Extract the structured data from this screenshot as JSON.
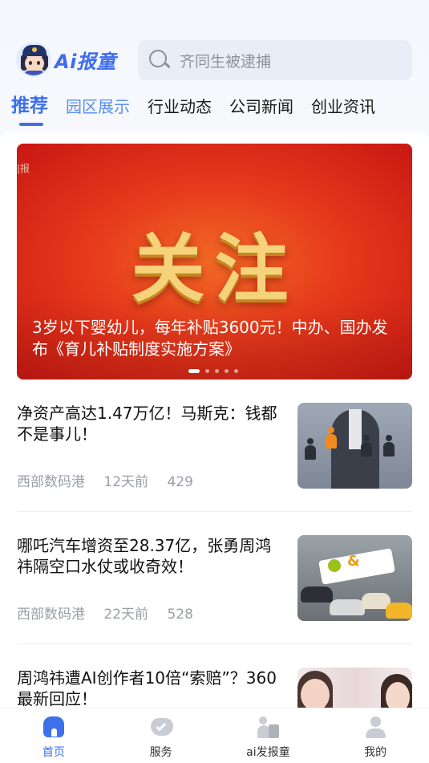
{
  "app": {
    "logo_text": "Ai报童"
  },
  "search": {
    "placeholder": "齐同生被逮捕"
  },
  "tabs": [
    {
      "label": "推荐"
    },
    {
      "label": "园区展示"
    },
    {
      "label": "行业动态"
    },
    {
      "label": "公司新闻"
    },
    {
      "label": "创业资讯"
    }
  ],
  "banner": {
    "tag": "|报",
    "big_text": "关注",
    "caption": "3岁以下婴幼儿，每年补贴3600元！中办、国办发布《育儿补贴制度实施方案》",
    "dots_count": 5,
    "active_dot": 0
  },
  "news": [
    {
      "title": "净资产高达1.47万亿！马斯克：钱都不是事儿！",
      "source": "西部数码港",
      "time": "12天前",
      "views": "429"
    },
    {
      "title": "哪吒汽车增资至28.37亿，张勇周鸿祎隔空口水仗或收奇效！",
      "source": "西部数码港",
      "time": "22天前",
      "views": "528"
    },
    {
      "title": "周鸿祎遭AI创作者10倍“索赔”？360最新回应！",
      "source": "",
      "time": "",
      "views": ""
    }
  ],
  "bottom_nav": [
    {
      "label": "首页",
      "icon": "home-icon"
    },
    {
      "label": "服务",
      "icon": "service-icon"
    },
    {
      "label": "ai发报童",
      "icon": "ai-report-icon"
    },
    {
      "label": "我的",
      "icon": "profile-icon"
    }
  ],
  "colors": {
    "accent": "#3d70ea",
    "banner_red": "#e63a1c",
    "banner_gold": "#f6d27a"
  }
}
